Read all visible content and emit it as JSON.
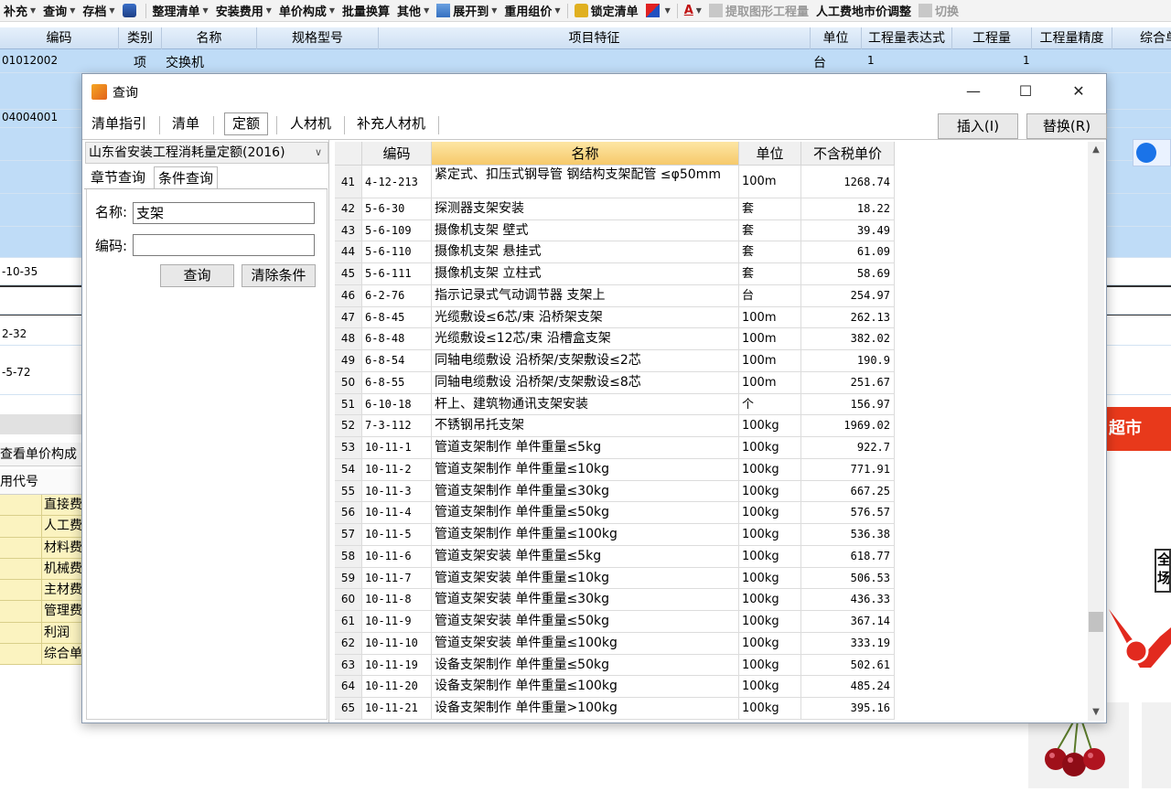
{
  "toolbar": {
    "items": [
      {
        "label": "补充",
        "has_arrow": true
      },
      {
        "label": "查询",
        "has_arrow": true
      },
      {
        "label": "存档",
        "has_arrow": true
      },
      {
        "label": "整理清单",
        "has_arrow": true
      },
      {
        "label": "安装费用",
        "has_arrow": true
      },
      {
        "label": "单价构成",
        "has_arrow": true
      },
      {
        "label": "批量换算",
        "has_arrow": false
      },
      {
        "label": "其他",
        "has_arrow": true
      },
      {
        "label": "展开到",
        "has_arrow": true
      },
      {
        "label": "重用组价",
        "has_arrow": true
      },
      {
        "label": "锁定清单",
        "has_arrow": false
      },
      {
        "label": "提取图形工程量",
        "has_arrow": false
      },
      {
        "label": "人工费地市价调整",
        "has_arrow": false
      },
      {
        "label": "切换",
        "has_arrow": false
      }
    ]
  },
  "grid": {
    "headers": [
      "编码",
      "类别",
      "名称",
      "规格型号",
      "项目特征",
      "单位",
      "工程量表达式",
      "工程量",
      "工程量精度",
      "综合单"
    ],
    "row1": {
      "code": "01012002",
      "type": "项",
      "name": "交换机",
      "unit": "台",
      "expr": "1",
      "qty": "1"
    },
    "row2_code": "04004001",
    "side_codes": [
      "-10-35",
      "2-32",
      "-5-72"
    ]
  },
  "bottom_panel": {
    "tab_label": "查看单价构成",
    "col_label": "用代号",
    "items": [
      "直接费",
      "人工费",
      "材料费",
      "机械费",
      "主材费",
      "管理费",
      "利润",
      "综合单"
    ]
  },
  "ad": {
    "red_text": "超市",
    "box_text": "全场"
  },
  "dialog": {
    "title": "查询",
    "tabs": [
      "清单指引",
      "清单",
      "定额",
      "人材机",
      "补充人材机"
    ],
    "active_tab": "定额",
    "insert_btn": "插入(I)",
    "replace_btn": "替换(R)",
    "library": "山东省安装工程消耗量定额(2016)",
    "subtabs": [
      "章节查询",
      "条件查询"
    ],
    "active_subtab": "条件查询",
    "form": {
      "name_label": "名称:",
      "name_value": "支架",
      "code_label": "编码:",
      "code_value": "",
      "search_btn": "查询",
      "clear_btn": "清除条件"
    },
    "table": {
      "columns": [
        "编码",
        "名称",
        "单位",
        "不含税单价"
      ],
      "rows": [
        {
          "n": "41",
          "code": "4-12-213",
          "name": "紧定式、扣压式钢导管 钢结构支架配管 ≤φ50mm",
          "unit": "100m",
          "price": "1268.74"
        },
        {
          "n": "42",
          "code": "5-6-30",
          "name": "探测器支架安装",
          "unit": "套",
          "price": "18.22"
        },
        {
          "n": "43",
          "code": "5-6-109",
          "name": "摄像机支架 壁式",
          "unit": "套",
          "price": "39.49"
        },
        {
          "n": "44",
          "code": "5-6-110",
          "name": "摄像机支架 悬挂式",
          "unit": "套",
          "price": "61.09"
        },
        {
          "n": "45",
          "code": "5-6-111",
          "name": "摄像机支架 立柱式",
          "unit": "套",
          "price": "58.69"
        },
        {
          "n": "46",
          "code": "6-2-76",
          "name": "指示记录式气动调节器 支架上",
          "unit": "台",
          "price": "254.97"
        },
        {
          "n": "47",
          "code": "6-8-45",
          "name": "光缆敷设≤6芯/束 沿桥架支架",
          "unit": "100m",
          "price": "262.13"
        },
        {
          "n": "48",
          "code": "6-8-48",
          "name": "光缆敷设≤12芯/束 沿槽盒支架",
          "unit": "100m",
          "price": "382.02"
        },
        {
          "n": "49",
          "code": "6-8-54",
          "name": "同轴电缆敷设 沿桥架/支架敷设≤2芯",
          "unit": "100m",
          "price": "190.9"
        },
        {
          "n": "50",
          "code": "6-8-55",
          "name": "同轴电缆敷设 沿桥架/支架敷设≤8芯",
          "unit": "100m",
          "price": "251.67"
        },
        {
          "n": "51",
          "code": "6-10-18",
          "name": "杆上、建筑物通讯支架安装",
          "unit": "个",
          "price": "156.97"
        },
        {
          "n": "52",
          "code": "7-3-112",
          "name": "不锈钢吊托支架",
          "unit": "100kg",
          "price": "1969.02"
        },
        {
          "n": "53",
          "code": "10-11-1",
          "name": "管道支架制作 单件重量≤5kg",
          "unit": "100kg",
          "price": "922.7"
        },
        {
          "n": "54",
          "code": "10-11-2",
          "name": "管道支架制作 单件重量≤10kg",
          "unit": "100kg",
          "price": "771.91"
        },
        {
          "n": "55",
          "code": "10-11-3",
          "name": "管道支架制作 单件重量≤30kg",
          "unit": "100kg",
          "price": "667.25"
        },
        {
          "n": "56",
          "code": "10-11-4",
          "name": "管道支架制作 单件重量≤50kg",
          "unit": "100kg",
          "price": "576.57"
        },
        {
          "n": "57",
          "code": "10-11-5",
          "name": "管道支架制作 单件重量≤100kg",
          "unit": "100kg",
          "price": "536.38"
        },
        {
          "n": "58",
          "code": "10-11-6",
          "name": "管道支架安装 单件重量≤5kg",
          "unit": "100kg",
          "price": "618.77"
        },
        {
          "n": "59",
          "code": "10-11-7",
          "name": "管道支架安装 单件重量≤10kg",
          "unit": "100kg",
          "price": "506.53"
        },
        {
          "n": "60",
          "code": "10-11-8",
          "name": "管道支架安装 单件重量≤30kg",
          "unit": "100kg",
          "price": "436.33"
        },
        {
          "n": "61",
          "code": "10-11-9",
          "name": "管道支架安装 单件重量≤50kg",
          "unit": "100kg",
          "price": "367.14"
        },
        {
          "n": "62",
          "code": "10-11-10",
          "name": "管道支架安装 单件重量≤100kg",
          "unit": "100kg",
          "price": "333.19"
        },
        {
          "n": "63",
          "code": "10-11-19",
          "name": "设备支架制作 单件重量≤50kg",
          "unit": "100kg",
          "price": "502.61"
        },
        {
          "n": "64",
          "code": "10-11-20",
          "name": "设备支架制作 单件重量≤100kg",
          "unit": "100kg",
          "price": "485.24"
        },
        {
          "n": "65",
          "code": "10-11-21",
          "name": "设备支架制作 单件重量>100kg",
          "unit": "100kg",
          "price": "395.16"
        }
      ]
    }
  },
  "colors": {
    "header_orange": "#f6c96b",
    "grid_blue": "#bfdcf7",
    "ad_red": "#e8391b",
    "yellow_row": "#fbf3c0"
  }
}
